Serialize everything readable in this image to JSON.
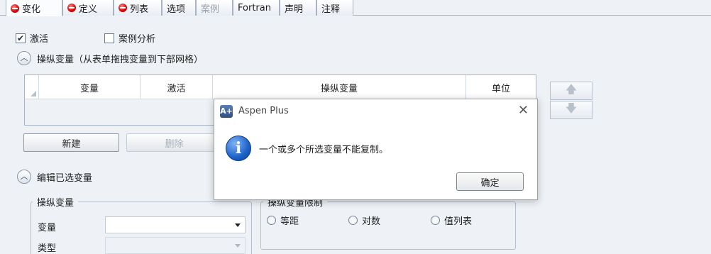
{
  "tabs": [
    {
      "label": "变化",
      "status_icon": "error-dot-icon",
      "active": true,
      "disabled": false
    },
    {
      "label": "定义",
      "status_icon": "error-dot-icon",
      "active": false,
      "disabled": false
    },
    {
      "label": "列表",
      "status_icon": "error-dot-icon",
      "active": false,
      "disabled": false
    },
    {
      "label": "选项",
      "status_icon": null,
      "active": false,
      "disabled": false
    },
    {
      "label": "案例",
      "status_icon": null,
      "active": false,
      "disabled": true
    },
    {
      "label": "Fortran",
      "status_icon": null,
      "active": false,
      "disabled": false
    },
    {
      "label": "声明",
      "status_icon": null,
      "active": false,
      "disabled": false
    },
    {
      "label": "注释",
      "status_icon": null,
      "active": false,
      "disabled": false
    }
  ],
  "options": {
    "activate_label": "激活",
    "activate_checked": true,
    "case_study_label": "案例分析",
    "case_study_checked": false
  },
  "manipulated_section": {
    "title": "操纵变量（从表单拖拽变量到下部网格）",
    "columns": [
      "变量",
      "激活",
      "操纵变量",
      "单位"
    ],
    "rows": []
  },
  "actions": {
    "new_label": "新建",
    "delete_label": "删除"
  },
  "edit_section": {
    "title": "编辑已选变量",
    "group_title": "操纵变量",
    "variable_label": "变量",
    "variable_value": "",
    "type_label": "类型",
    "type_value": "",
    "limits_group_title": "操纵变量限制",
    "radio_options": [
      "等距",
      "对数",
      "值列表"
    ]
  },
  "dialog": {
    "title": "Aspen Plus",
    "icon": "info-icon",
    "message": "一个或多个所选变量不能复制。",
    "ok_label": "确定",
    "close_glyph": "✕"
  },
  "colors": {
    "background": "#eef2f7",
    "status_error": "#d40000",
    "info_blue": "#1e62c8"
  }
}
